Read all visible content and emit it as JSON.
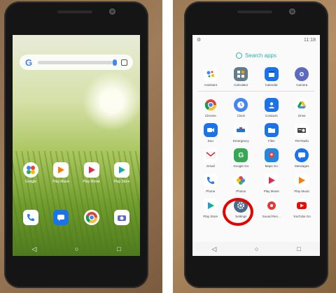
{
  "left_phone": {
    "status_time": "",
    "search_hint": "",
    "home_apps": [
      {
        "label": "Google",
        "icon": "google-folder-icon",
        "color": "#ffffff"
      },
      {
        "label": "Play Music",
        "icon": "play-music-icon",
        "color": "#ff7a00"
      },
      {
        "label": "Play Movie",
        "icon": "play-movies-icon",
        "color": "#e02b49"
      },
      {
        "label": "Play Store",
        "icon": "play-store-icon",
        "color": "#ffffff"
      }
    ],
    "dock_apps": [
      {
        "label": "",
        "icon": "phone-icon",
        "color": "#2b7de9"
      },
      {
        "label": "",
        "icon": "messages-icon",
        "color": "#1a73e8"
      },
      {
        "label": "",
        "icon": "chrome-icon",
        "color": "#ffffff"
      },
      {
        "label": "",
        "icon": "camera-icon",
        "color": "#ffffff"
      }
    ],
    "nav": [
      "◁",
      "○",
      "□"
    ]
  },
  "right_phone": {
    "status_time": "11:18",
    "search_placeholder": "Search apps",
    "top_row": [
      {
        "label": "Assistant",
        "icon": "assistant-icon",
        "color": "#ffffff"
      },
      {
        "label": "Calculator",
        "icon": "calculator-icon",
        "color": "#607d8b"
      },
      {
        "label": "Calendar",
        "icon": "calendar-icon",
        "color": "#1a73e8"
      },
      {
        "label": "Camera",
        "icon": "camera-icon",
        "color": "#5c6bc0"
      }
    ],
    "apps": [
      {
        "label": "Chrome",
        "icon": "chrome-icon",
        "color": "#ffffff"
      },
      {
        "label": "Clock",
        "icon": "clock-icon",
        "color": "#4285f4"
      },
      {
        "label": "Contacts",
        "icon": "contacts-icon",
        "color": "#1a73e8"
      },
      {
        "label": "Drive",
        "icon": "drive-icon",
        "color": "#ffffff"
      },
      {
        "label": "Duo",
        "icon": "duo-icon",
        "color": "#1a73e8"
      },
      {
        "label": "Emergency",
        "icon": "emergency-icon",
        "color": "#ffffff"
      },
      {
        "label": "Files",
        "icon": "files-icon",
        "color": "#1a73e8"
      },
      {
        "label": "FM Radio",
        "icon": "radio-icon",
        "color": "#424242"
      },
      {
        "label": "Gmail",
        "icon": "gmail-icon",
        "color": "#ffffff"
      },
      {
        "label": "Google Go",
        "icon": "google-go-icon",
        "color": "#34a853"
      },
      {
        "label": "Maps Go",
        "icon": "maps-go-icon",
        "color": "#1e88e5"
      },
      {
        "label": "Messages",
        "icon": "messages-icon",
        "color": "#1a73e8"
      },
      {
        "label": "Phone",
        "icon": "phone-icon",
        "color": "#ffffff"
      },
      {
        "label": "Photos",
        "icon": "photos-icon",
        "color": "#ffffff"
      },
      {
        "label": "Play Movie",
        "icon": "play-movies-icon",
        "color": "#ffffff"
      },
      {
        "label": "Play Music",
        "icon": "play-music-icon",
        "color": "#ffffff"
      },
      {
        "label": "Play Store",
        "icon": "play-store-icon",
        "color": "#ffffff"
      },
      {
        "label": "Settings",
        "icon": "settings-gear-icon",
        "color": "#4b6a88"
      },
      {
        "label": "Sound Rec...",
        "icon": "sound-recorder-icon",
        "color": "#ffffff"
      },
      {
        "label": "YouTube Go",
        "icon": "youtube-go-icon",
        "color": "#ffffff"
      }
    ],
    "nav": [
      "◁",
      "○",
      "□"
    ],
    "highlight_color": "#e60000"
  }
}
